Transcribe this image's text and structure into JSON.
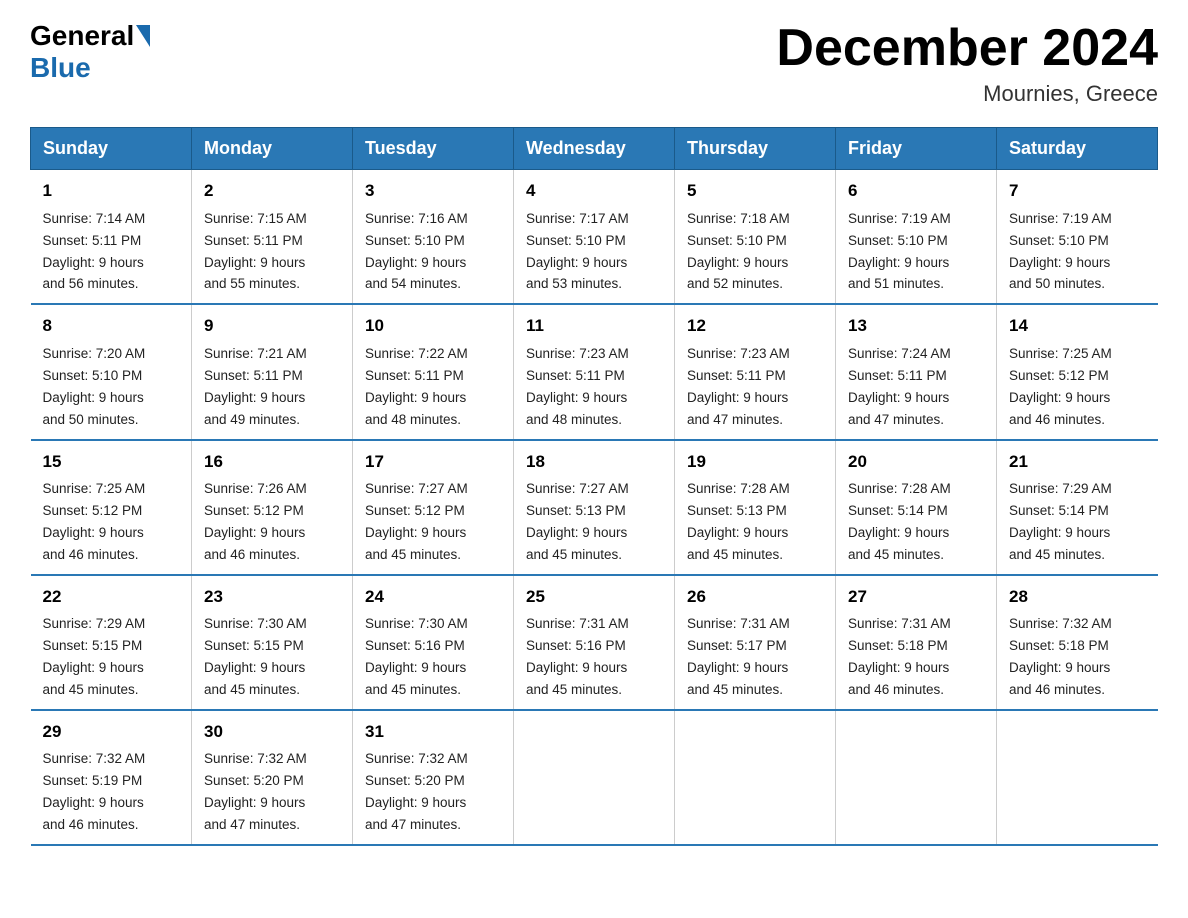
{
  "header": {
    "logo_general": "General",
    "logo_blue": "Blue",
    "month_year": "December 2024",
    "location": "Mournies, Greece"
  },
  "days_of_week": [
    "Sunday",
    "Monday",
    "Tuesday",
    "Wednesday",
    "Thursday",
    "Friday",
    "Saturday"
  ],
  "weeks": [
    [
      {
        "day": "1",
        "sunrise": "7:14 AM",
        "sunset": "5:11 PM",
        "daylight": "9 hours and 56 minutes."
      },
      {
        "day": "2",
        "sunrise": "7:15 AM",
        "sunset": "5:11 PM",
        "daylight": "9 hours and 55 minutes."
      },
      {
        "day": "3",
        "sunrise": "7:16 AM",
        "sunset": "5:10 PM",
        "daylight": "9 hours and 54 minutes."
      },
      {
        "day": "4",
        "sunrise": "7:17 AM",
        "sunset": "5:10 PM",
        "daylight": "9 hours and 53 minutes."
      },
      {
        "day": "5",
        "sunrise": "7:18 AM",
        "sunset": "5:10 PM",
        "daylight": "9 hours and 52 minutes."
      },
      {
        "day": "6",
        "sunrise": "7:19 AM",
        "sunset": "5:10 PM",
        "daylight": "9 hours and 51 minutes."
      },
      {
        "day": "7",
        "sunrise": "7:19 AM",
        "sunset": "5:10 PM",
        "daylight": "9 hours and 50 minutes."
      }
    ],
    [
      {
        "day": "8",
        "sunrise": "7:20 AM",
        "sunset": "5:10 PM",
        "daylight": "9 hours and 50 minutes."
      },
      {
        "day": "9",
        "sunrise": "7:21 AM",
        "sunset": "5:11 PM",
        "daylight": "9 hours and 49 minutes."
      },
      {
        "day": "10",
        "sunrise": "7:22 AM",
        "sunset": "5:11 PM",
        "daylight": "9 hours and 48 minutes."
      },
      {
        "day": "11",
        "sunrise": "7:23 AM",
        "sunset": "5:11 PM",
        "daylight": "9 hours and 48 minutes."
      },
      {
        "day": "12",
        "sunrise": "7:23 AM",
        "sunset": "5:11 PM",
        "daylight": "9 hours and 47 minutes."
      },
      {
        "day": "13",
        "sunrise": "7:24 AM",
        "sunset": "5:11 PM",
        "daylight": "9 hours and 47 minutes."
      },
      {
        "day": "14",
        "sunrise": "7:25 AM",
        "sunset": "5:12 PM",
        "daylight": "9 hours and 46 minutes."
      }
    ],
    [
      {
        "day": "15",
        "sunrise": "7:25 AM",
        "sunset": "5:12 PM",
        "daylight": "9 hours and 46 minutes."
      },
      {
        "day": "16",
        "sunrise": "7:26 AM",
        "sunset": "5:12 PM",
        "daylight": "9 hours and 46 minutes."
      },
      {
        "day": "17",
        "sunrise": "7:27 AM",
        "sunset": "5:12 PM",
        "daylight": "9 hours and 45 minutes."
      },
      {
        "day": "18",
        "sunrise": "7:27 AM",
        "sunset": "5:13 PM",
        "daylight": "9 hours and 45 minutes."
      },
      {
        "day": "19",
        "sunrise": "7:28 AM",
        "sunset": "5:13 PM",
        "daylight": "9 hours and 45 minutes."
      },
      {
        "day": "20",
        "sunrise": "7:28 AM",
        "sunset": "5:14 PM",
        "daylight": "9 hours and 45 minutes."
      },
      {
        "day": "21",
        "sunrise": "7:29 AM",
        "sunset": "5:14 PM",
        "daylight": "9 hours and 45 minutes."
      }
    ],
    [
      {
        "day": "22",
        "sunrise": "7:29 AM",
        "sunset": "5:15 PM",
        "daylight": "9 hours and 45 minutes."
      },
      {
        "day": "23",
        "sunrise": "7:30 AM",
        "sunset": "5:15 PM",
        "daylight": "9 hours and 45 minutes."
      },
      {
        "day": "24",
        "sunrise": "7:30 AM",
        "sunset": "5:16 PM",
        "daylight": "9 hours and 45 minutes."
      },
      {
        "day": "25",
        "sunrise": "7:31 AM",
        "sunset": "5:16 PM",
        "daylight": "9 hours and 45 minutes."
      },
      {
        "day": "26",
        "sunrise": "7:31 AM",
        "sunset": "5:17 PM",
        "daylight": "9 hours and 45 minutes."
      },
      {
        "day": "27",
        "sunrise": "7:31 AM",
        "sunset": "5:18 PM",
        "daylight": "9 hours and 46 minutes."
      },
      {
        "day": "28",
        "sunrise": "7:32 AM",
        "sunset": "5:18 PM",
        "daylight": "9 hours and 46 minutes."
      }
    ],
    [
      {
        "day": "29",
        "sunrise": "7:32 AM",
        "sunset": "5:19 PM",
        "daylight": "9 hours and 46 minutes."
      },
      {
        "day": "30",
        "sunrise": "7:32 AM",
        "sunset": "5:20 PM",
        "daylight": "9 hours and 47 minutes."
      },
      {
        "day": "31",
        "sunrise": "7:32 AM",
        "sunset": "5:20 PM",
        "daylight": "9 hours and 47 minutes."
      },
      null,
      null,
      null,
      null
    ]
  ],
  "labels": {
    "sunrise": "Sunrise:",
    "sunset": "Sunset:",
    "daylight": "Daylight:"
  }
}
